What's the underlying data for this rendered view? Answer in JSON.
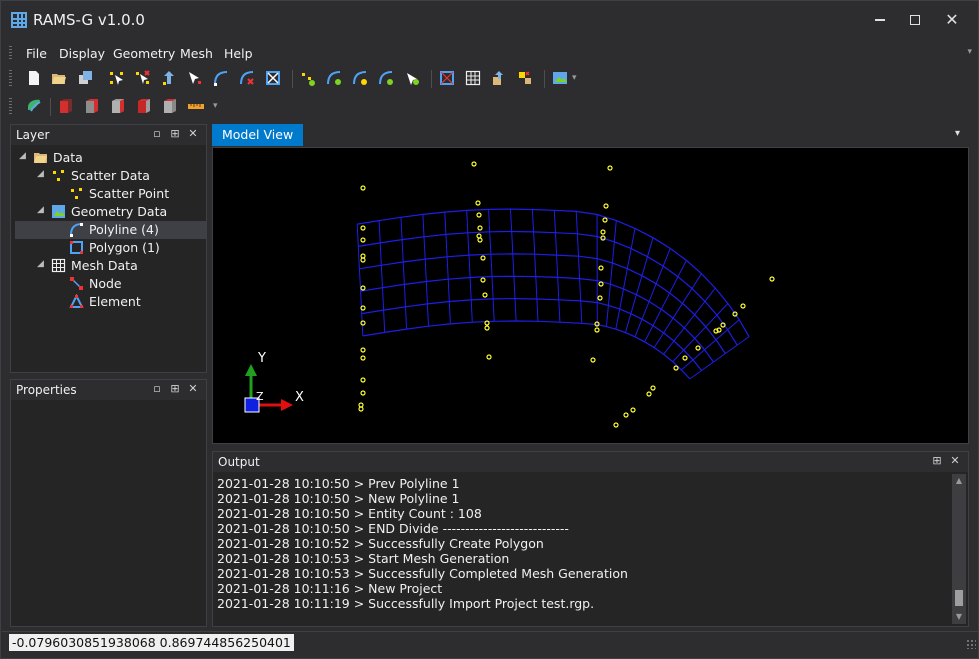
{
  "app": {
    "title": "RAMS-G v1.0.0",
    "accent": "#007acc"
  },
  "window_controls": {
    "minimize": "minimize-icon",
    "maximize": "maximize-icon",
    "close": "✕"
  },
  "menu": {
    "items": [
      "File",
      "Display",
      "Geometry",
      "Mesh",
      "Help"
    ],
    "overflow": "▾"
  },
  "toolbar1": {
    "icons": [
      "new-file-icon",
      "open-folder-icon",
      "save-icon",
      "add-point-icon",
      "delete-point-icon",
      "move-point-icon",
      "select-point-icon",
      "add-polyline-icon",
      "delete-polyline-icon",
      "select-polyline-icon",
      "point-tool-a-icon",
      "line-tool-a-icon",
      "line-tool-b-icon",
      "line-tool-c-icon",
      "line-tool-d-icon",
      "polygon-icon",
      "mesh-grid-icon",
      "mesh-export-icon",
      "mesh-import-icon",
      "map-image-icon"
    ]
  },
  "toolbar2": {
    "icons": [
      "render-icon",
      "view-front-icon",
      "view-back-icon",
      "view-left-icon",
      "view-right-icon",
      "view-top-icon",
      "ruler-icon"
    ]
  },
  "layer_panel": {
    "title": "Layer",
    "buttons": [
      "▫",
      "⊞",
      "✕"
    ],
    "tree": [
      {
        "label": "Data",
        "icon": "folder-icon",
        "expander": "◢",
        "level": 0
      },
      {
        "label": "Scatter Data",
        "icon": "scatter-icon",
        "expander": "◢",
        "level": 1
      },
      {
        "label": "Scatter Point",
        "icon": "scatter-point-icon",
        "expander": "",
        "level": 2
      },
      {
        "label": "Geometry Data",
        "icon": "geometry-icon",
        "expander": "◢",
        "level": 1
      },
      {
        "label": "Polyline (4)",
        "icon": "polyline-icon",
        "expander": "",
        "level": 2,
        "selected": true
      },
      {
        "label": "Polygon (1)",
        "icon": "polygon-icon",
        "expander": "",
        "level": 2
      },
      {
        "label": "Mesh Data",
        "icon": "mesh-icon",
        "expander": "◢",
        "level": 1
      },
      {
        "label": "Node",
        "icon": "node-icon",
        "expander": "",
        "level": 2
      },
      {
        "label": "Element",
        "icon": "element-icon",
        "expander": "",
        "level": 2
      }
    ]
  },
  "properties_panel": {
    "title": "Properties",
    "buttons": [
      "▫",
      "⊞",
      "✕"
    ]
  },
  "model_view": {
    "tab_label": "Model View",
    "tab_dropdown": "▾",
    "axis_y_label": "Y",
    "axis_z_label": "Z",
    "axis_x_label": "X",
    "mesh_color": "#1e1ee6",
    "point_color": "#ffff33"
  },
  "output_panel": {
    "title": "Output",
    "buttons": [
      "⊞",
      "✕"
    ],
    "lines": [
      "2021-01-28 10:10:50 > Prev Polyline 1",
      "2021-01-28 10:10:50 > New Polyline 1",
      "2021-01-28 10:10:50 > Entity Count : 108",
      "2021-01-28 10:10:50 > END Divide ----------------------------",
      "2021-01-28 10:10:52 > Successfully Create Polygon",
      "2021-01-28 10:10:53 > Start Mesh Generation",
      "2021-01-28 10:10:53 > Successfully Completed Mesh Generation",
      "2021-01-28 10:11:16 > New Project",
      "2021-01-28 10:11:19 > Successfully Import Project test.rgp."
    ]
  },
  "status": {
    "coordinates": "-0.0796030851938068 0.869744856250401"
  }
}
